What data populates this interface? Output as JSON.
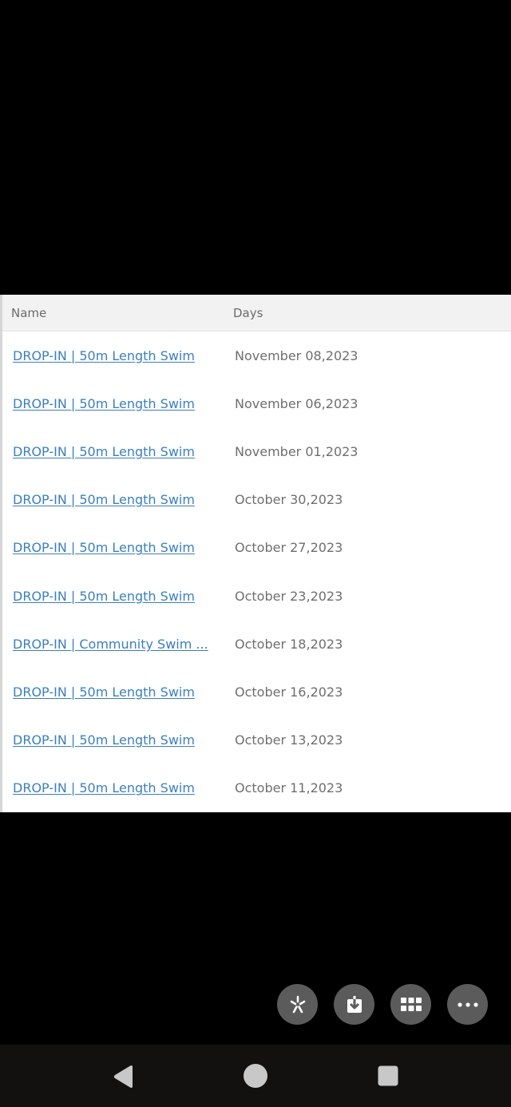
{
  "table": {
    "headers": {
      "name": "Name",
      "days": "Days"
    },
    "rows": [
      {
        "name": "DROP-IN | 50m Length Swim",
        "days": "November 08,2023"
      },
      {
        "name": "DROP-IN | 50m Length Swim",
        "days": "November 06,2023"
      },
      {
        "name": "DROP-IN | 50m Length Swim",
        "days": "November 01,2023"
      },
      {
        "name": "DROP-IN | 50m Length Swim",
        "days": "October 30,2023"
      },
      {
        "name": "DROP-IN | 50m Length Swim",
        "days": "October 27,2023"
      },
      {
        "name": "DROP-IN | 50m Length Swim",
        "days": "October 23,2023"
      },
      {
        "name": "DROP-IN | Community Swim ...",
        "days": "October 18,2023"
      },
      {
        "name": "DROP-IN | 50m Length Swim",
        "days": "October 16,2023"
      },
      {
        "name": "DROP-IN | 50m Length Swim",
        "days": "October 13,2023"
      },
      {
        "name": "DROP-IN | 50m Length Swim",
        "days": "October 11,2023"
      }
    ]
  },
  "floating_actions": [
    {
      "icon": "sparkle-icon"
    },
    {
      "icon": "download-icon"
    },
    {
      "icon": "grid-icon"
    },
    {
      "icon": "more-horizontal-icon"
    }
  ],
  "system_nav": [
    {
      "icon": "back-triangle-icon"
    },
    {
      "icon": "home-circle-icon"
    },
    {
      "icon": "recents-square-icon"
    }
  ],
  "colors": {
    "link": "#3a7fc0",
    "header_bg": "#f2f2f2",
    "fab_bg": "#5b5b5b",
    "nav_bg": "#12110f"
  }
}
